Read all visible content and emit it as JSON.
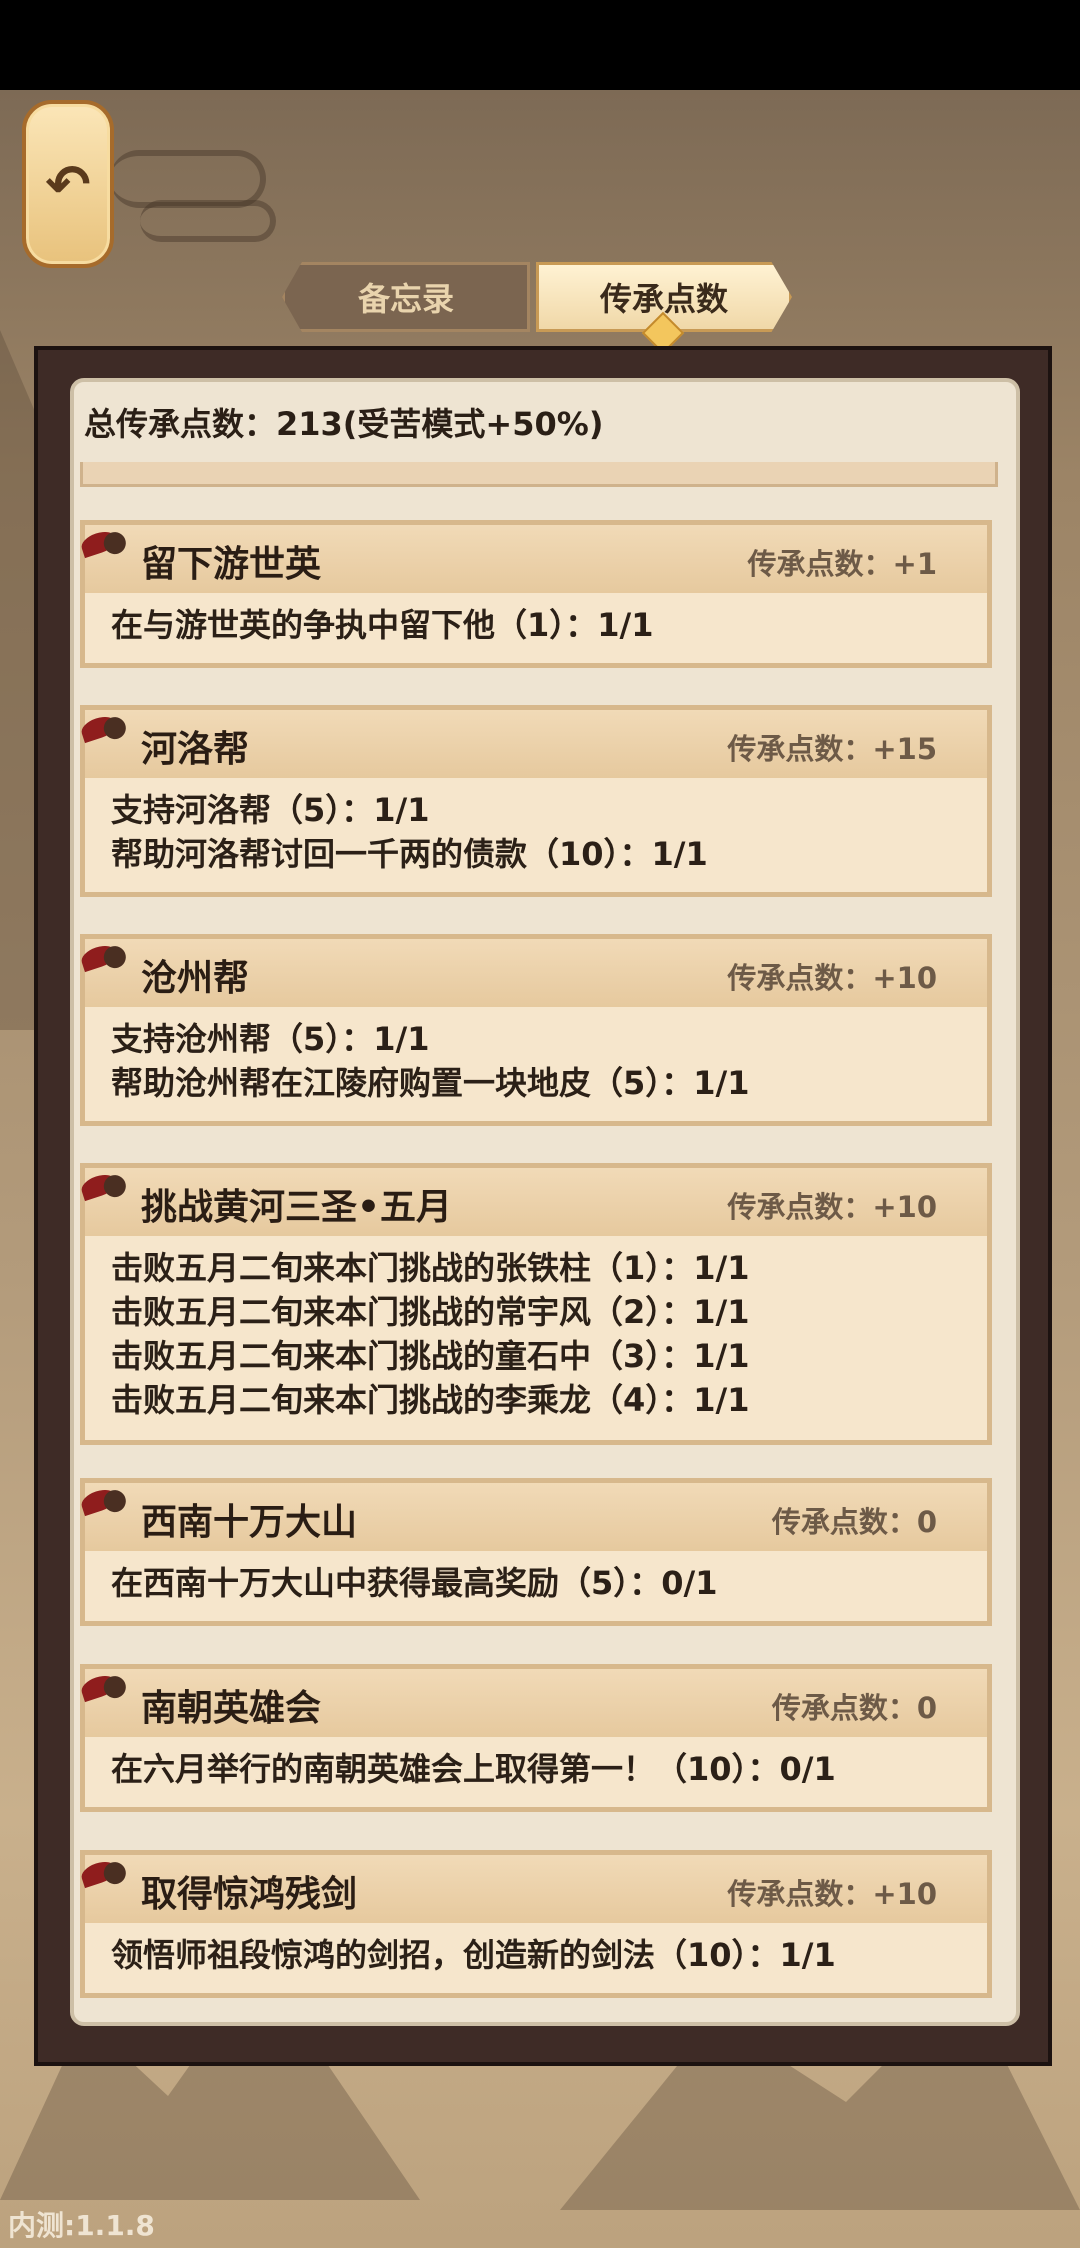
{
  "tabs": [
    {
      "label": "备忘录",
      "active": false
    },
    {
      "label": "传承点数",
      "active": true
    }
  ],
  "total_points": "总传承点数：213(受苦模式+50%)",
  "version": "内测:1.1.8",
  "colors": {
    "accent": "#f3c65d",
    "panel": "#eee4d2",
    "card": "#f6e6cc",
    "ribbon": "#8f1d1d"
  },
  "icons": {
    "back": "return-arrow-icon",
    "ribbon": "red-ribbon-icon"
  },
  "cards": [
    {
      "title": "留下游世英",
      "points": "传承点数：+1",
      "lines": [
        "在与游世英的争执中留下他（1）：1/1"
      ]
    },
    {
      "title": "河洛帮",
      "points": "传承点数：+15",
      "lines": [
        "支持河洛帮（5）：1/1",
        "帮助河洛帮讨回一千两的债款（10）：1/1"
      ]
    },
    {
      "title": "沧州帮",
      "points": "传承点数：+10",
      "lines": [
        "支持沧州帮（5）：1/1",
        "帮助沧州帮在江陵府购置一块地皮（5）：1/1"
      ]
    },
    {
      "title": "挑战黄河三圣•五月",
      "points": "传承点数：+10",
      "lines": [
        "击败五月二旬来本门挑战的张铁柱（1）：1/1",
        "击败五月二旬来本门挑战的常宇风（2）：1/1",
        "击败五月二旬来本门挑战的童石中（3）：1/1",
        "击败五月二旬来本门挑战的李乘龙（4）：1/1"
      ]
    },
    {
      "title": "西南十万大山",
      "points": "传承点数：0",
      "lines": [
        "在西南十万大山中获得最高奖励（5）：0/1"
      ]
    },
    {
      "title": "南朝英雄会",
      "points": "传承点数：0",
      "lines": [
        "在六月举行的南朝英雄会上取得第一！（10）：0/1"
      ]
    },
    {
      "title": "取得惊鸿残剑",
      "points": "传承点数：+10",
      "lines": [
        "领悟师祖段惊鸿的剑招，创造新的剑法（10）：1/1"
      ]
    }
  ]
}
